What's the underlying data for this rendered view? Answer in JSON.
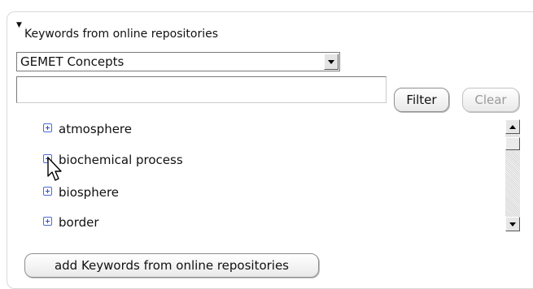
{
  "panel": {
    "title": "Keywords from online repositories"
  },
  "repository_select": {
    "selected": "GEMET Concepts"
  },
  "filter": {
    "value": "",
    "placeholder": "",
    "filter_label": "Filter",
    "clear_label": "Clear"
  },
  "tree": {
    "items": [
      {
        "label": "atmosphere",
        "icon": "expand-plus-icon"
      },
      {
        "label": "biochemical process",
        "icon": "expand-plus-icon"
      },
      {
        "label": "biosphere",
        "icon": "expand-plus-icon"
      },
      {
        "label": "border",
        "icon": "expand-plus-icon"
      }
    ]
  },
  "actions": {
    "add_label": "add Keywords from online repositories"
  },
  "colors": {
    "expand_icon": "#2a4fc7",
    "disabled_text": "#9a9a9a"
  }
}
